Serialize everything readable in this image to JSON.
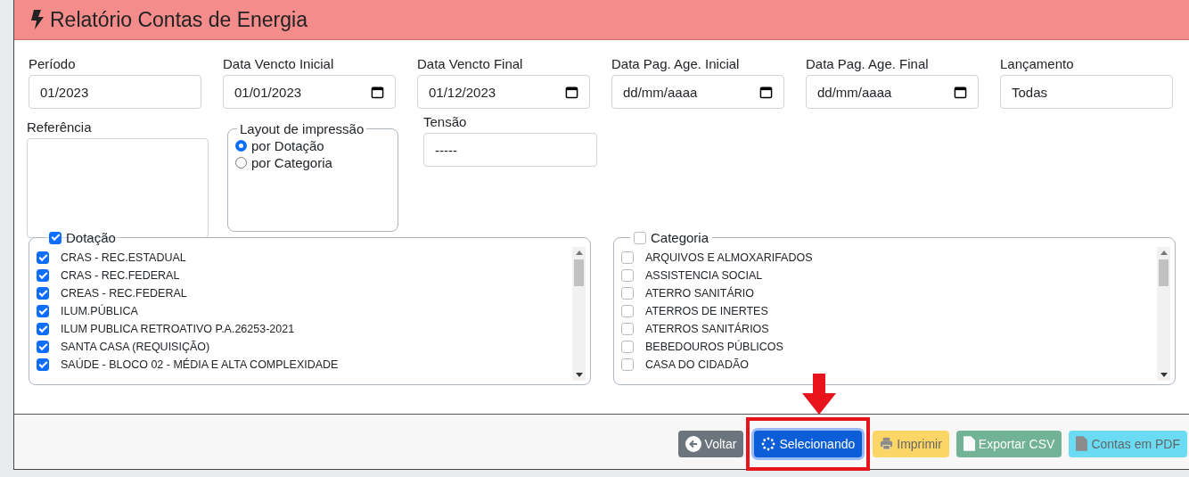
{
  "header": {
    "title": "Relatório Contas de Energia"
  },
  "fields": [
    {
      "label": "Período",
      "kind": "text",
      "value": "01/2023"
    },
    {
      "label": "Data Vencto Inicial",
      "kind": "date",
      "value": "01/01/2023"
    },
    {
      "label": "Data Vencto Final",
      "kind": "date",
      "value": "01/12/2023"
    },
    {
      "label": "Data Pag. Age. Inicial",
      "kind": "date",
      "placeholder": "dd/mm/aaaa"
    },
    {
      "label": "Data Pag. Age. Final",
      "kind": "date",
      "placeholder": "dd/mm/aaaa"
    },
    {
      "label": "Lançamento",
      "kind": "text",
      "value": "Todas"
    }
  ],
  "referencia": {
    "label": "Referência"
  },
  "layout": {
    "legend": "Layout de impressão",
    "options": [
      {
        "label": "por Dotação",
        "selected": true
      },
      {
        "label": "por Categoria",
        "selected": false
      }
    ]
  },
  "tensao": {
    "label": "Tensão",
    "value": "-----"
  },
  "groups": [
    {
      "legend": "Dotação",
      "checked": true,
      "items": [
        {
          "label": "CRAS - REC.ESTADUAL",
          "checked": true
        },
        {
          "label": "CRAS - REC.FEDERAL",
          "checked": true
        },
        {
          "label": "CREAS - REC.FEDERAL",
          "checked": true
        },
        {
          "label": "ILUM.PÚBLICA",
          "checked": true
        },
        {
          "label": "ILUM PUBLICA RETROATIVO P.A.26253-2021",
          "checked": true
        },
        {
          "label": "SANTA CASA (REQUISIÇÃO)",
          "checked": true
        },
        {
          "label": "SAÚDE - BLOCO 02 - MÉDIA E ALTA COMPLEXIDADE",
          "checked": true
        }
      ]
    },
    {
      "legend": "Categoria",
      "checked": false,
      "items": [
        {
          "label": "ARQUIVOS E ALMOXARIFADOS",
          "checked": false
        },
        {
          "label": "ASSISTENCIA SOCIAL",
          "checked": false
        },
        {
          "label": "ATERRO SANITÁRIO",
          "checked": false
        },
        {
          "label": "ATERROS DE INERTES",
          "checked": false
        },
        {
          "label": "ATERROS SANITÁRIOS",
          "checked": false
        },
        {
          "label": "BEBEDOUROS PÚBLICOS",
          "checked": false
        },
        {
          "label": "CASA DO CIDADÃO",
          "checked": false
        }
      ]
    }
  ],
  "buttons": [
    {
      "label": "Voltar",
      "kind": "back",
      "disabled": false
    },
    {
      "label": "Selecionando",
      "kind": "loading",
      "disabled": false
    },
    {
      "label": "Imprimir",
      "kind": "print",
      "disabled": true
    },
    {
      "label": "Exportar CSV",
      "kind": "csv",
      "disabled": true
    },
    {
      "label": "Contas em PDF",
      "kind": "pdf",
      "disabled": true
    }
  ]
}
